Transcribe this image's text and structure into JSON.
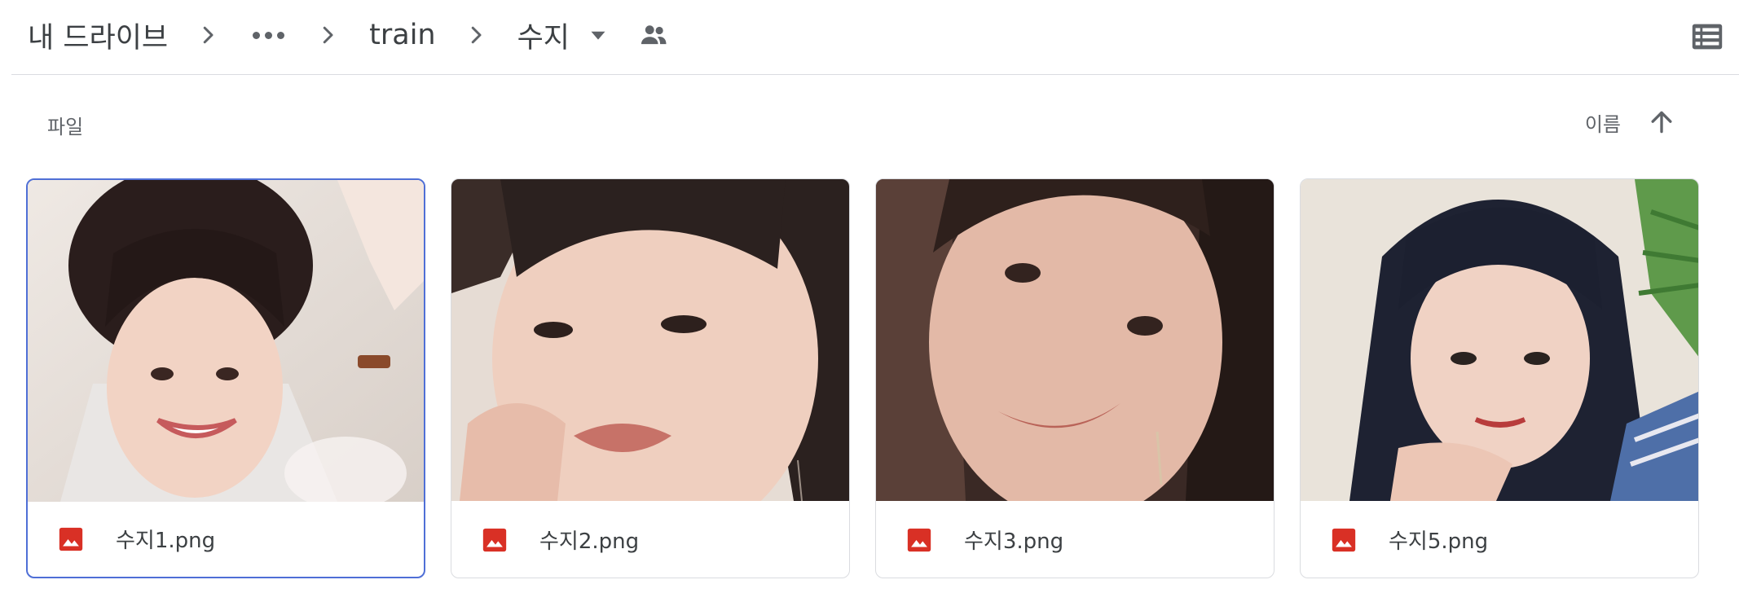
{
  "breadcrumb": {
    "items": [
      {
        "label": "내 드라이브"
      },
      {
        "label": "train"
      },
      {
        "label": "수지"
      }
    ]
  },
  "section": {
    "label": "파일"
  },
  "sort": {
    "label": "이름",
    "direction": "ascending"
  },
  "files": [
    {
      "name": "수지1.png",
      "selected": true
    },
    {
      "name": "수지2.png",
      "selected": false
    },
    {
      "name": "수지3.png",
      "selected": false
    },
    {
      "name": "수지5.png",
      "selected": false
    }
  ],
  "colors": {
    "text": "#3c4043",
    "muted": "#5f6368",
    "divider": "#dadce0",
    "selected_border": "#4f6fd6",
    "image_icon": "#d93025"
  },
  "icons": {
    "separator": "chevron-right-icon",
    "more": "more-horiz-icon",
    "dropdown": "caret-down-icon",
    "shared": "people-icon",
    "view": "list-view-icon",
    "sort": "arrow-up-icon",
    "file_type": "image-file-icon"
  }
}
